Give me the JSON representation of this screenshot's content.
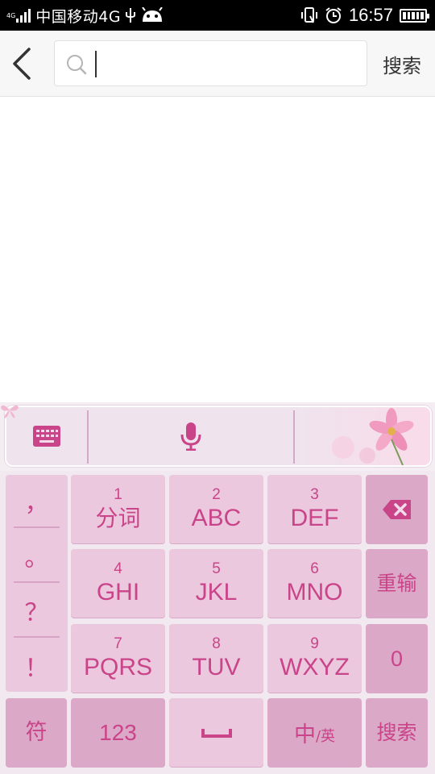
{
  "status_bar": {
    "network": "4G",
    "carrier": "中国移动4G",
    "time": "16:57",
    "icons": [
      "signal-icon",
      "usb-icon",
      "android-icon",
      "vibrate-icon",
      "alarm-icon",
      "battery-icon"
    ]
  },
  "header": {
    "back_icon": "chevron-left-icon",
    "search": {
      "value": "",
      "placeholder": ""
    },
    "search_button": "搜索"
  },
  "keyboard": {
    "toolbar": {
      "items": [
        "keyboard-icon",
        "microphone-icon",
        "chevron-down-icon"
      ]
    },
    "punctuation": [
      "，",
      "。",
      "？",
      "！"
    ],
    "keys": [
      {
        "num": "1",
        "label": "分词"
      },
      {
        "num": "2",
        "label": "ABC"
      },
      {
        "num": "3",
        "label": "DEF"
      },
      {
        "num": "4",
        "label": "GHI"
      },
      {
        "num": "5",
        "label": "JKL"
      },
      {
        "num": "6",
        "label": "MNO"
      },
      {
        "num": "7",
        "label": "PQRS"
      },
      {
        "num": "8",
        "label": "TUV"
      },
      {
        "num": "9",
        "label": "WXYZ"
      }
    ],
    "backspace_icon": "backspace-icon",
    "retype": "重输",
    "zero": "0",
    "symbols": "符",
    "numbers": "123",
    "space_icon": "space-icon",
    "lang_main": "中",
    "lang_alt": "/英",
    "search": "搜索"
  },
  "colors": {
    "accent": "#c94489",
    "key": "#e6bcd8",
    "status_bar": "#000000"
  }
}
